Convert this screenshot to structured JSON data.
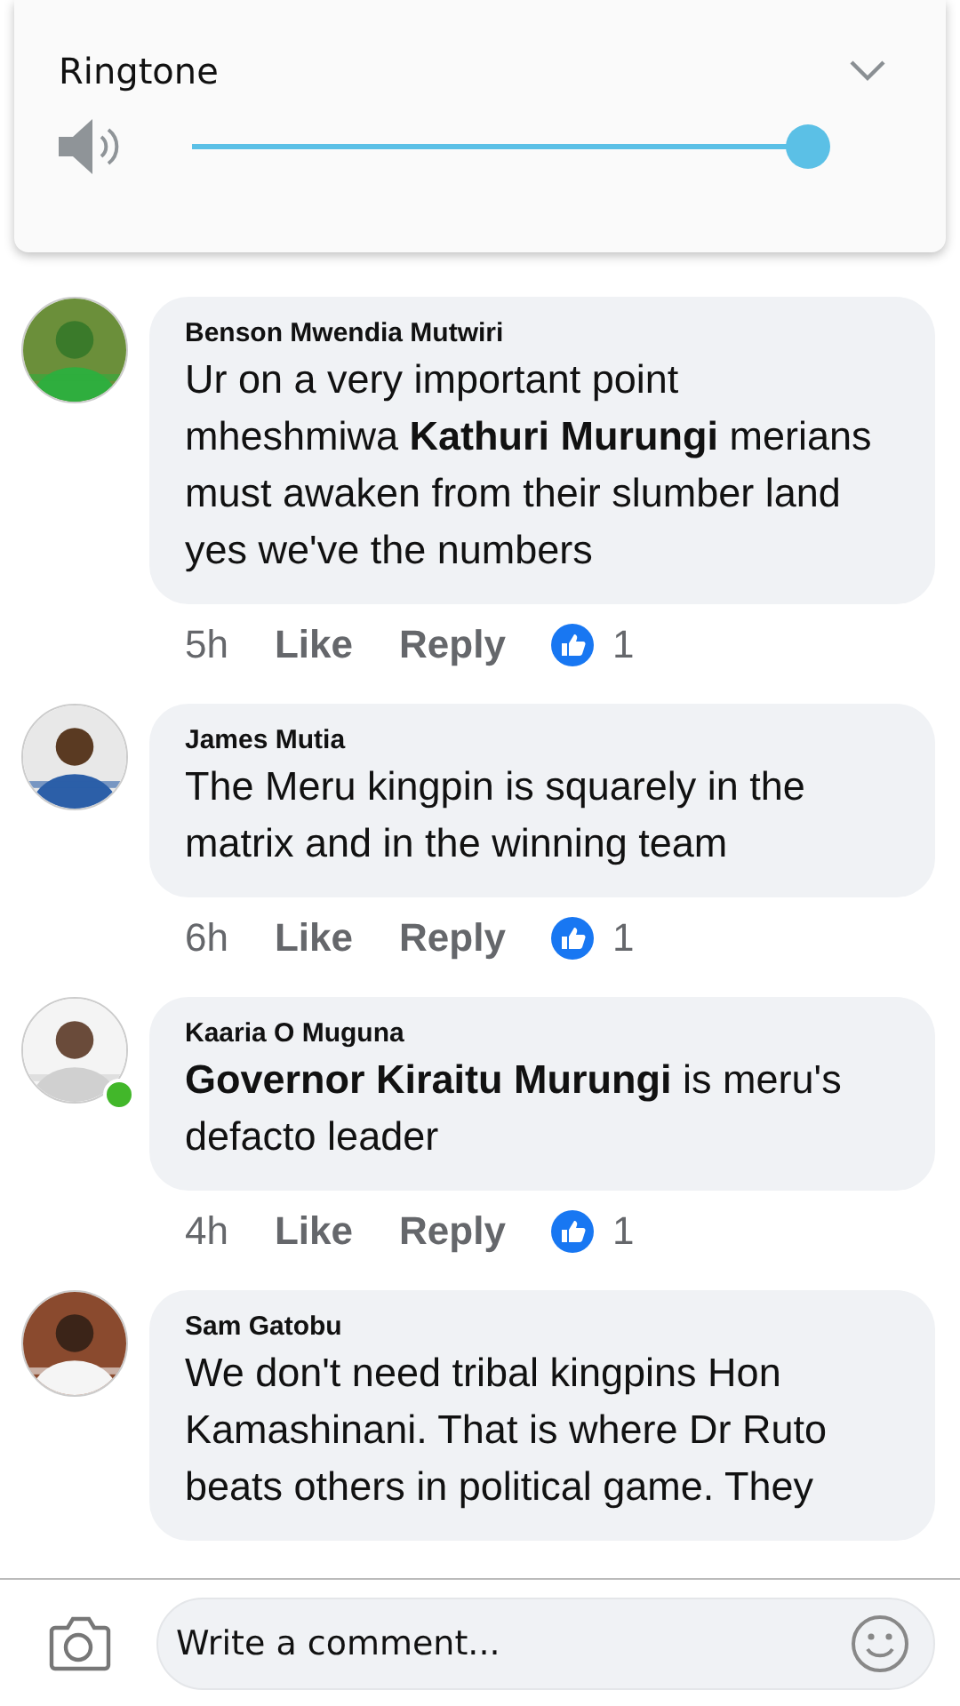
{
  "volume_panel": {
    "title": "Ringtone",
    "slider": {
      "level": 1
    }
  },
  "comments": [
    {
      "author": "Benson Mwendia Mutwiri",
      "text": "Ur on a very important point mheshmiwa **Kathuri Murungi** merians must awaken from their slumber land yes we've the numbers",
      "time": "5h",
      "like": "Like",
      "reply": "Reply",
      "reactions": "1",
      "online": false
    },
    {
      "author": "James Mutia",
      "text": "The Meru kingpin is squarely in the matrix and in the winning team",
      "time": "6h",
      "like": "Like",
      "reply": "Reply",
      "reactions": "1",
      "online": false
    },
    {
      "author": "Kaaria O Muguna",
      "text": "**Governor Kiraitu Murungi** is meru's defacto leader",
      "time": "4h",
      "like": "Like",
      "reply": "Reply",
      "reactions": "1",
      "online": true
    },
    {
      "author": "Sam Gatobu",
      "text": "We don't need tribal kingpins Hon Kamashinani. That is where Dr Ruto beats others in political game. They",
      "online": false
    }
  ],
  "composer": {
    "placeholder": "Write a comment..."
  }
}
